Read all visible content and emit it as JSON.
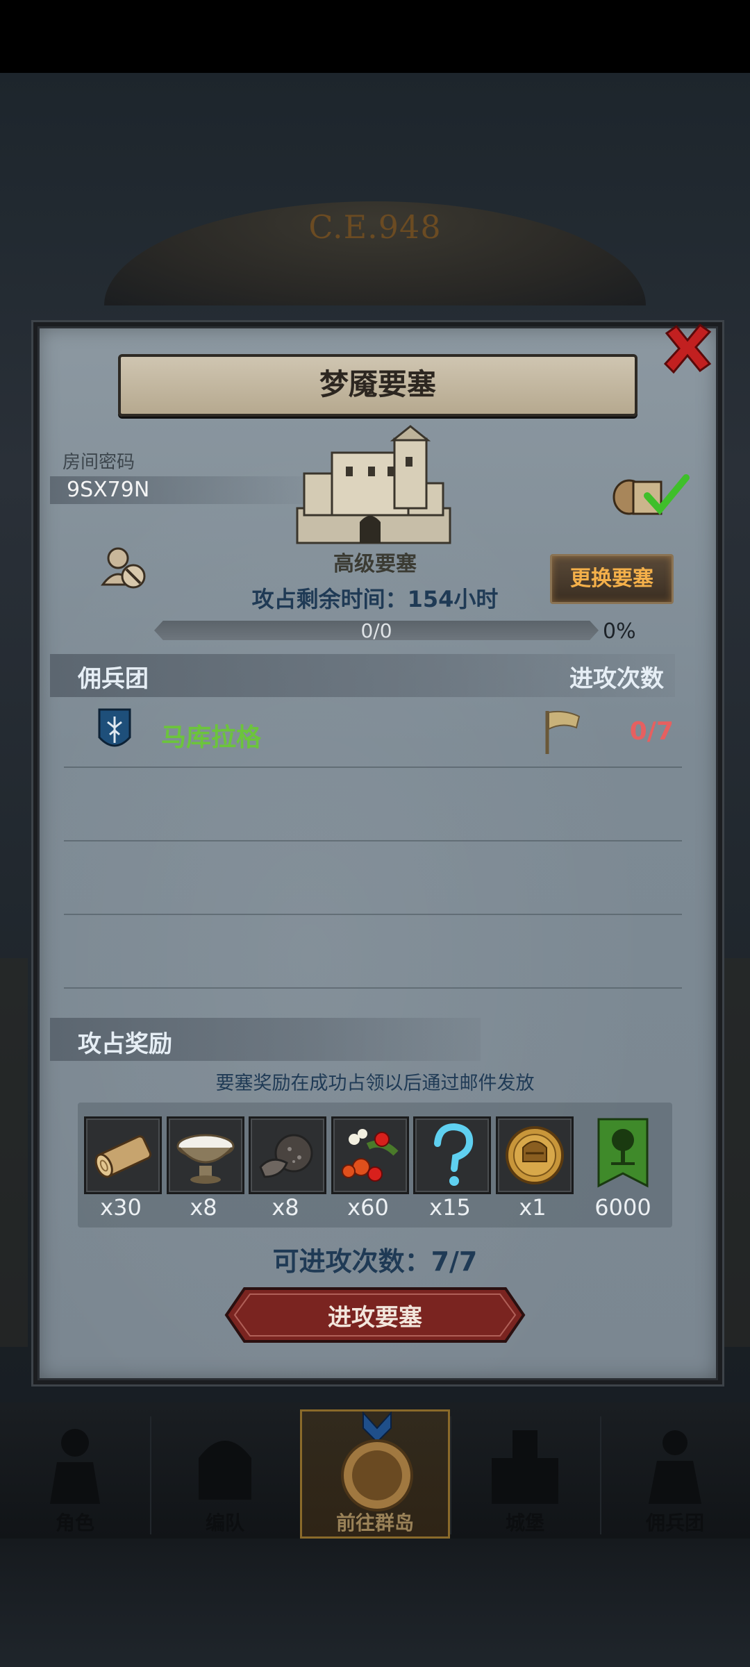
{
  "era": "C.E.948",
  "dialog": {
    "title": "梦魇要塞",
    "room_label": "房间密码",
    "room_code": "9SX79N",
    "fort_grade": "高级要塞",
    "change_button": "更换要塞",
    "timer": "攻占剩余时间：154小时",
    "progress_text": "0/0",
    "progress_percent": "0%",
    "progress_value": 0
  },
  "mercenary": {
    "section_title": "佣兵团",
    "attacks_title": "进攻次数",
    "entries": [
      {
        "name": "马库拉格",
        "attacks": "0/7"
      }
    ]
  },
  "rewards": {
    "section_title": "攻占奖励",
    "note": "要塞奖励在成功占领以后通过邮件发放",
    "items": [
      {
        "icon": "wood-log-icon",
        "qty": "x30"
      },
      {
        "icon": "milk-bowl-icon",
        "qty": "x8"
      },
      {
        "icon": "truffle-icon",
        "qty": "x8"
      },
      {
        "icon": "berries-icon",
        "qty": "x60"
      },
      {
        "icon": "mystery-question-icon",
        "qty": "x15"
      },
      {
        "icon": "helmet-coin-icon",
        "qty": "x1"
      },
      {
        "icon": "tree-banner-icon",
        "qty": "6000"
      }
    ]
  },
  "attack_count": "可进攻次数：7/7",
  "attack_button": "进攻要塞",
  "nav": [
    {
      "label": "角色"
    },
    {
      "label": "编队"
    },
    {
      "label": "前往群岛",
      "active": true
    },
    {
      "label": "城堡"
    },
    {
      "label": "佣兵团"
    }
  ],
  "colors": {
    "merc_name": "#6cc43c",
    "attacks_red": "#e66060",
    "change_button_text": "#f4b04a",
    "check_green": "#3fbf2a"
  }
}
